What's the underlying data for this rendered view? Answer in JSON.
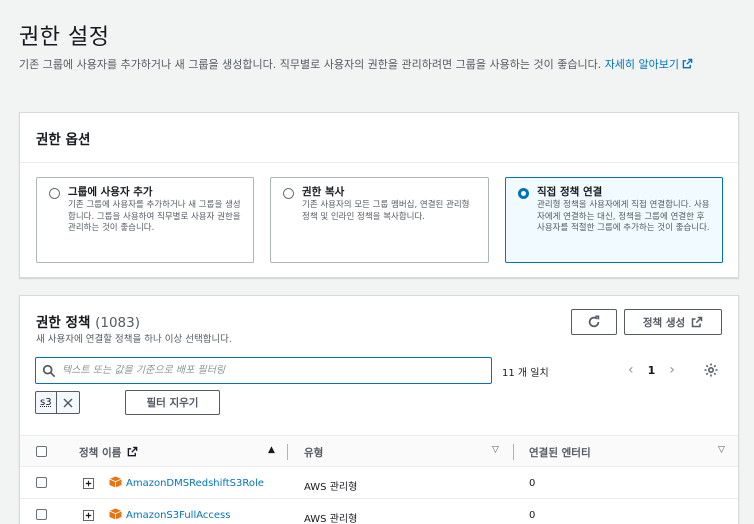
{
  "page": {
    "title": "권한 설정",
    "description": "기존 그룹에 사용자를 추가하거나 새 그룹을 생성합니다. 직무별로 사용자의 권한을 관리하려면 그룹을 사용하는 것이 좋습니다.",
    "learn_more": "자세히 알아보기"
  },
  "options": {
    "header": "권한 옵션",
    "tiles": [
      {
        "title": "그룹에 사용자 추가",
        "desc": "기존 그룹에 사용자를 추가하거나 새 그룹을 생성합니다. 그룹을 사용하여 직무별로 사용자 권한을 관리하는 것이 좋습니다.",
        "selected": false
      },
      {
        "title": "권한 복사",
        "desc": "기존 사용자의 모든 그룹 멤버십, 연결된 관리형 정책 및 인라인 정책을 복사합니다.",
        "selected": false
      },
      {
        "title": "직접 정책 연결",
        "desc": "관리형 정책을 사용자에게 직접 연결합니다. 사용자에게 연결하는 대신, 정책을 그룹에 연결한 후 사용자를 적절한 그룹에 추가하는 것이 좋습니다.",
        "selected": true
      }
    ]
  },
  "policies": {
    "title": "권한 정책",
    "count": "(1083)",
    "subtitle": "새 사용자에 연결할 정책을 하나 이상 선택합니다.",
    "create_button": "정책 생성",
    "search_placeholder": "텍스트 또는 값을 기준으로 배포 필터링",
    "match_count": "11 개 일치",
    "page_number": "1",
    "filter_token": "s3",
    "clear_button": "필터 지우기",
    "columns": {
      "name": "정책 이름",
      "type": "유형",
      "entities": "연결된 엔터티"
    },
    "rows": [
      {
        "name": "AmazonDMSRedshiftS3Role",
        "type": "AWS 관리형",
        "entities": "0"
      },
      {
        "name": "AmazonS3FullAccess",
        "type": "AWS 관리형",
        "entities": "0"
      }
    ]
  },
  "colors": {
    "accent": "#0073bb",
    "text": "#16191f",
    "muted": "#545b64",
    "package_icon": "#ec7211"
  }
}
